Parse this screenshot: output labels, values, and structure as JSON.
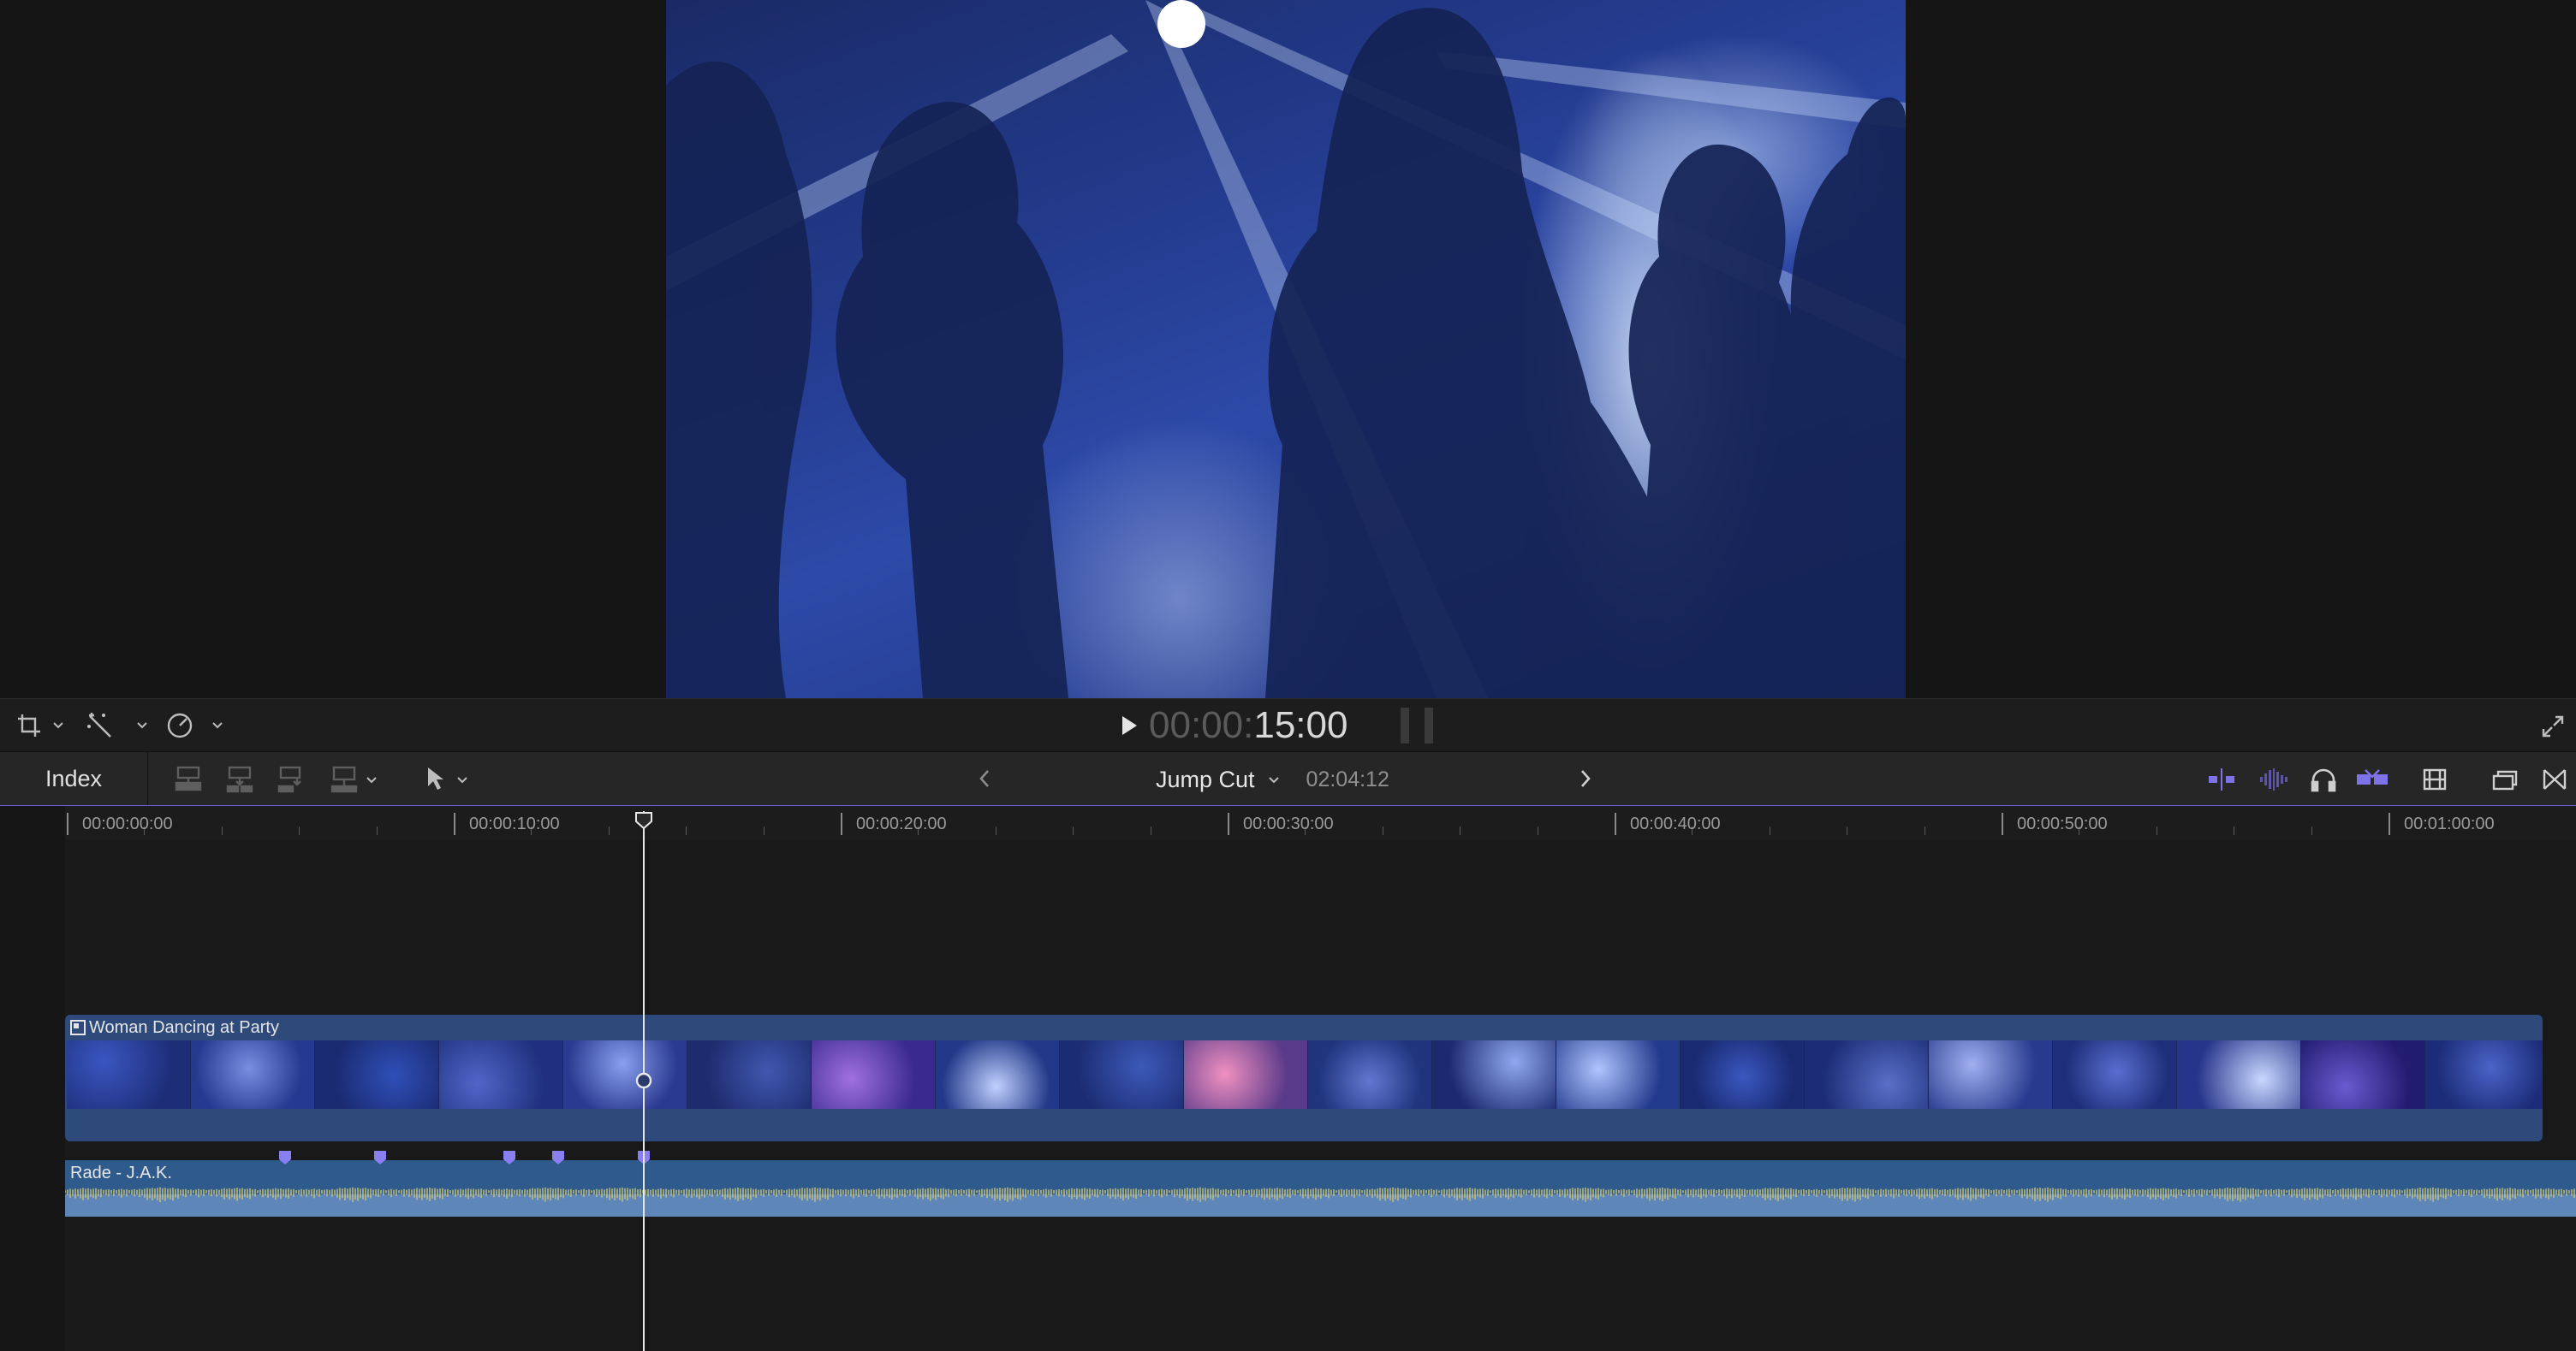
{
  "transport": {
    "timecode_dim": "00:00:",
    "timecode_bright": "15:00"
  },
  "toolbar": {
    "index_label": "Index",
    "project_name": "Jump Cut",
    "duration": "02:04:12"
  },
  "ruler": {
    "labels": [
      "00:00:00:00",
      "00:00:10:00",
      "00:00:20:00",
      "00:00:30:00",
      "00:00:40:00",
      "00:00:50:00",
      "00:01:00:00"
    ]
  },
  "timeline": {
    "video_clip_name": "Woman Dancing at Party",
    "audio_clip_name": "Rade - J.A.K.",
    "playhead_position_seconds": 15,
    "marker_count": 5
  },
  "colors": {
    "accent": "#6b5fd6",
    "video_clip": "#2d4a7a",
    "audio_clip": "#2f5a8c",
    "waveform": "#c9c47a"
  },
  "icons": [
    "crop-icon",
    "magic-wand-icon",
    "speed-icon",
    "play-icon",
    "fullscreen-icon",
    "connect-clip-icon",
    "insert-clip-icon",
    "append-clip-icon",
    "overwrite-clip-icon",
    "select-tool-icon",
    "chevron-left-icon",
    "chevron-right-icon",
    "skimming-icon",
    "audio-skimming-icon",
    "headphones-icon",
    "snapping-icon",
    "clip-appearance-icon",
    "timeline-index-icon",
    "transitions-icon"
  ]
}
